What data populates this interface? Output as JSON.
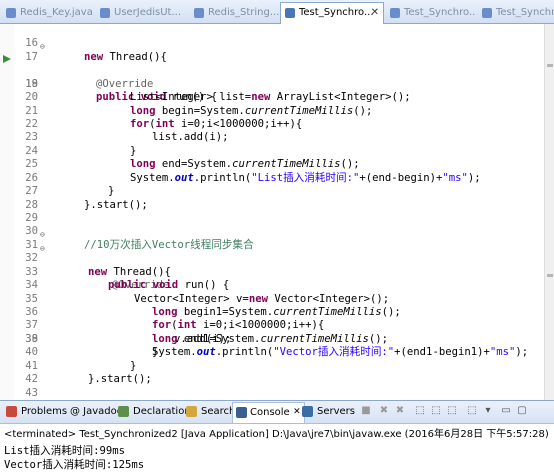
{
  "editor_tabs": [
    {
      "label": "Redis_Key.java",
      "active": false
    },
    {
      "label": "UserJedisUt...",
      "active": false
    },
    {
      "label": "Redis_String...",
      "active": false
    },
    {
      "label": "Test_Synchro...",
      "active": true
    },
    {
      "label": "Test_Synchro...",
      "active": false
    },
    {
      "label": "Test_Synchro...",
      "active": false
    }
  ],
  "tab_close_glyph": "✕",
  "line_numbers": [
    "16",
    "17",
    "18",
    "19",
    "20",
    "21",
    "22",
    "23",
    "24",
    "25",
    "26",
    "27",
    "28",
    "29",
    "30",
    "31",
    "32",
    "33",
    "34",
    "35",
    "36",
    "37",
    "38",
    "39",
    "40",
    "41",
    "42",
    "43"
  ],
  "code": {
    "l16": {
      "kw": "new",
      "rest": " Thread(){"
    },
    "l17": {
      "ann": "@Override"
    },
    "l18": {
      "kw1": "public",
      "kw2": "void",
      "rest": " run() {"
    },
    "l19": {
      "a": "List<Integer> list=",
      "kw": "new",
      "b": " ArrayList<Integer>();"
    },
    "l20": {
      "kw": "long",
      "a": " begin=System.",
      "m": "currentTimeMillis",
      "b": "();"
    },
    "l21": {
      "kw1": "for",
      "a": "(",
      "kw2": "int",
      "b": " i=0;i<1000000;i++){"
    },
    "l22": {
      "text": "list.add(i);"
    },
    "l23": {
      "text": "}"
    },
    "l24": {
      "kw": "long",
      "a": " end=System.",
      "m": "currentTimeMillis",
      "b": "();"
    },
    "l25": {
      "a": "System.",
      "f": "out",
      "b": ".println(",
      "s": "\"List插入消耗时间:\"",
      "c": "+(end-begin)+",
      "s2": "\"ms\"",
      "d": ");"
    },
    "l26": {
      "text": "}"
    },
    "l27": {
      "text": "}.start();"
    },
    "l30": {
      "cmt": "//10万次插入Vector线程同步集合"
    },
    "l31": {
      "kw": "new",
      "rest": " Thread(){"
    },
    "l32": {
      "ann": "@Override"
    },
    "l33": {
      "kw1": "public",
      "kw2": "void",
      "rest": " run() {"
    },
    "l34": {
      "a": "Vector<Integer> v=",
      "kw": "new",
      "b": " Vector<Integer>();"
    },
    "l35": {
      "kw": "long",
      "a": " begin1=System.",
      "m": "currentTimeMillis",
      "b": "();"
    },
    "l36": {
      "kw1": "for",
      "a": "(",
      "kw2": "int",
      "b": " i=0;i<1000000;i++){"
    },
    "l37": {
      "text": "v.add(i);"
    },
    "l38": {
      "text": "}"
    },
    "l39": {
      "kw": "long",
      "a": " end1=System.",
      "m": "currentTimeMillis",
      "b": "();"
    },
    "l40": {
      "a": "System.",
      "f": "out",
      "b": ".println(",
      "s": "\"Vector插入消耗时间:\"",
      "c": "+(end1-begin1)+",
      "s2": "\"ms\"",
      "d": ");"
    },
    "l41": {
      "text": "}"
    },
    "l42": {
      "text": "}.start();"
    }
  },
  "fold_glyph": "⊖",
  "view_tabs": [
    {
      "label": "Problems",
      "active": false,
      "color": "#c94a3a"
    },
    {
      "label": "@ Javadoc",
      "active": false,
      "color": "#4d79b8"
    },
    {
      "label": "Declaration",
      "active": false,
      "color": "#5b8f4a"
    },
    {
      "label": "Search",
      "active": false,
      "color": "#d4a640"
    },
    {
      "label": "Console",
      "active": true,
      "color": "#3b5f91"
    },
    {
      "label": "Servers",
      "active": false,
      "color": "#3a6ea5"
    }
  ],
  "console_close_glyph": "✕",
  "console_tools": [
    "■",
    "✖",
    "✖",
    "⬚",
    "⬚",
    "⬚",
    "⬚",
    "▾",
    "▭",
    "▢"
  ],
  "terminated_line": "<terminated> Test_Synchronized2 [Java Application] D:\\Java\\jre7\\bin\\javaw.exe (2016年6月28日 下午5:57:28)",
  "output_lines": [
    "List插入消耗时间:99ms",
    "Vector插入消耗时间:125ms"
  ],
  "colors": {
    "keyword": "#7f0055",
    "string": "#2a00ff",
    "comment": "#3f7f5f",
    "annotation": "#646464",
    "field": "#0000c0"
  }
}
